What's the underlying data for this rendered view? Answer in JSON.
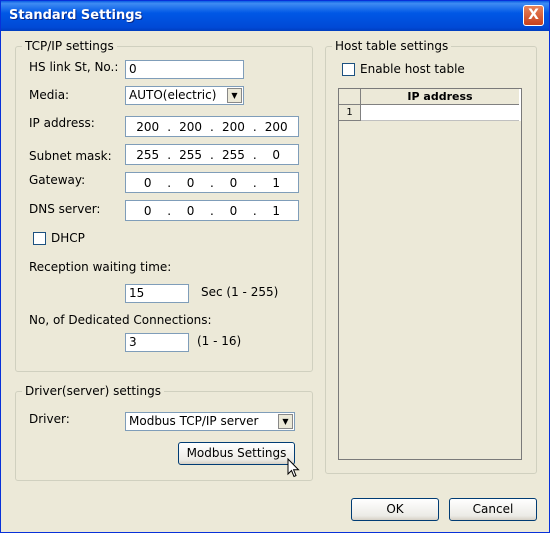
{
  "window": {
    "title": "Standard Settings",
    "close_glyph": "X"
  },
  "tcpip": {
    "legend": "TCP/IP settings",
    "hs_link_label": "HS link St, No.:",
    "hs_link_value": "0",
    "media_label": "Media:",
    "media_value": "AUTO(electric)",
    "ip_label": "IP address:",
    "ip": [
      "200",
      "200",
      "200",
      "200"
    ],
    "subnet_label": "Subnet mask:",
    "subnet": [
      "255",
      "255",
      "255",
      "0"
    ],
    "gateway_label": "Gateway:",
    "gateway": [
      "0",
      "0",
      "0",
      "1"
    ],
    "dns_label": "DNS server:",
    "dns": [
      "0",
      "0",
      "0",
      "1"
    ],
    "dhcp_label": "DHCP",
    "dhcp_checked": false,
    "reception_label": "Reception waiting time:",
    "reception_value": "15",
    "reception_unit": "Sec (1 - 255)",
    "dedicated_label": "No, of Dedicated Connections:",
    "dedicated_value": "3",
    "dedicated_range": "(1 - 16)"
  },
  "driver": {
    "legend": "Driver(server) settings",
    "driver_label": "Driver:",
    "driver_value": "Modbus TCP/IP server",
    "modbus_button": "Modbus Settings"
  },
  "host": {
    "legend": "Host table settings",
    "enable_label": "Enable host table",
    "enable_checked": false,
    "column_header": "IP address",
    "rows": [
      {
        "num": "1",
        "ip": ""
      }
    ]
  },
  "footer": {
    "ok": "OK",
    "cancel": "Cancel"
  },
  "colors": {
    "title_bar": "#0058e6",
    "dialog_bg": "#ece9d8",
    "close_button": "#c8401d"
  },
  "icons": {
    "dropdown": "chevron-down-icon",
    "close": "close-icon",
    "cursor": "mouse-pointer-icon"
  }
}
